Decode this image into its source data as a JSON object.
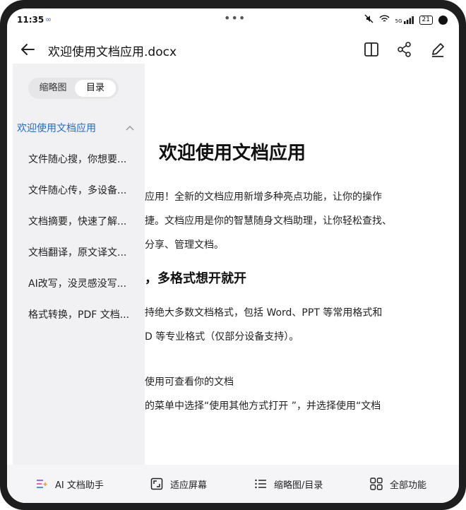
{
  "status": {
    "time": "11:35",
    "time_extra": "∞",
    "dots": "•••",
    "signal_label": "5G",
    "battery": "21"
  },
  "header": {
    "title": "欢迎使用文档应用.docx"
  },
  "sidebar": {
    "tab_thumbnail": "缩略图",
    "tab_toc": "目录",
    "items": [
      {
        "label": "欢迎使用文档应用"
      },
      {
        "label": "文件随心搜，你想要..."
      },
      {
        "label": "文件随心传，多设备..."
      },
      {
        "label": "文档摘要，快速了解..."
      },
      {
        "label": "文档翻译，原文译文..."
      },
      {
        "label": "AI改写，没灵感没写..."
      },
      {
        "label": "格式转换，PDF 文档..."
      }
    ]
  },
  "document": {
    "heading": "欢迎使用文档应用",
    "para1_line1": "应用！全新的文档应用新增多种亮点功能，让你的操作",
    "para1_line2": "捷。文档应用是你的智慧随身文档助理，让你轻松查找、",
    "para1_line3": "分享、管理文档。",
    "section_heading": "，多格式想开就开",
    "para2_line1": "持绝大多数文档格式，包括 Word、PPT 等常用格式和",
    "para2_line2": "D 等专业格式（仅部分设备支持）。",
    "para3_line1": "使用可查看你的文档",
    "para3_line2": "的菜单中选择“使用其他方式打开 ”，并选择使用“文档"
  },
  "bottombar": {
    "ai_label": "AI 文档助手",
    "fit_label": "适应屏幕",
    "thumb_label": "缩略图/目录",
    "all_label": "全部功能"
  },
  "colors": {
    "accent": "#1f6bd8",
    "sidebar_bg": "#f1f1f3",
    "bottombar_bg": "#f5f5f7"
  }
}
